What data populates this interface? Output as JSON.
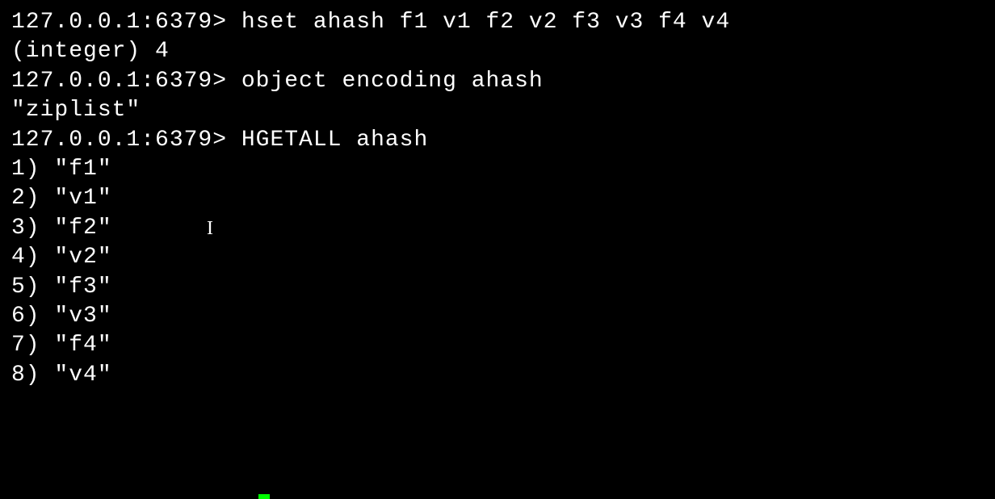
{
  "lines": [
    {
      "prompt": "127.0.0.1:6379> ",
      "command": "hset ahash f1 v1 f2 v2 f3 v3 f4 v4"
    },
    {
      "output": "(integer) 4"
    },
    {
      "prompt": "127.0.0.1:6379> ",
      "command": "object encoding ahash"
    },
    {
      "output": "\"ziplist\""
    },
    {
      "prompt": "127.0.0.1:6379> ",
      "command": "HGETALL ahash"
    },
    {
      "output": "1) \"f1\""
    },
    {
      "output": "2) \"v1\""
    },
    {
      "output": "3) \"f2\""
    },
    {
      "output": "4) \"v2\""
    },
    {
      "output": "5) \"f3\""
    },
    {
      "output": "6) \"v3\""
    },
    {
      "output": "7) \"f4\""
    },
    {
      "output": "8) \"v4\""
    }
  ],
  "text_cursor_glyph": "I"
}
